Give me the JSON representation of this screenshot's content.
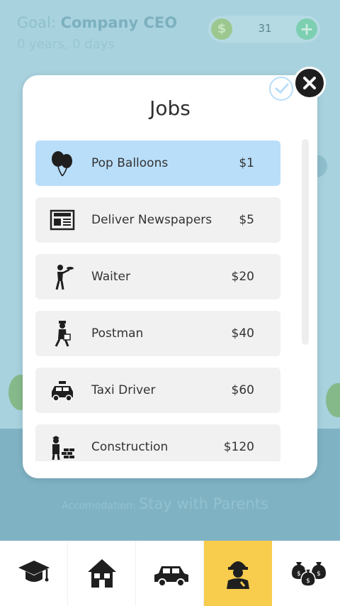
{
  "header": {
    "goal_label": "Goal:",
    "goal_value": "Company CEO",
    "age": "0 years, 0 days",
    "money": "31",
    "coin_symbol": "$",
    "plus_symbol": "+"
  },
  "modal": {
    "title": "Jobs",
    "jobs": [
      {
        "name": "Pop Balloons",
        "price": "$1",
        "icon": "balloons-icon",
        "selected": true
      },
      {
        "name": "Deliver Newspapers",
        "price": "$5",
        "icon": "newspaper-icon"
      },
      {
        "name": "Waiter",
        "price": "$20",
        "icon": "waiter-icon"
      },
      {
        "name": "Postman",
        "price": "$40",
        "icon": "postman-icon"
      },
      {
        "name": "Taxi Driver",
        "price": "$60",
        "icon": "taxi-icon"
      },
      {
        "name": "Construction",
        "price": "$120",
        "icon": "construction-worker-icon"
      }
    ]
  },
  "footer": {
    "accommodation_label": "Accomodation:",
    "accommodation_value": "Stay with Parents"
  },
  "nav": {
    "items": [
      {
        "icon": "graduation-cap-icon"
      },
      {
        "icon": "house-icon"
      },
      {
        "icon": "car-icon"
      },
      {
        "icon": "worker-icon",
        "active": true
      },
      {
        "icon": "money-bags-icon"
      }
    ]
  },
  "colors": {
    "background": "#a8d2de",
    "selected_row": "#b9def9",
    "nav_active": "#f8cc4d"
  }
}
